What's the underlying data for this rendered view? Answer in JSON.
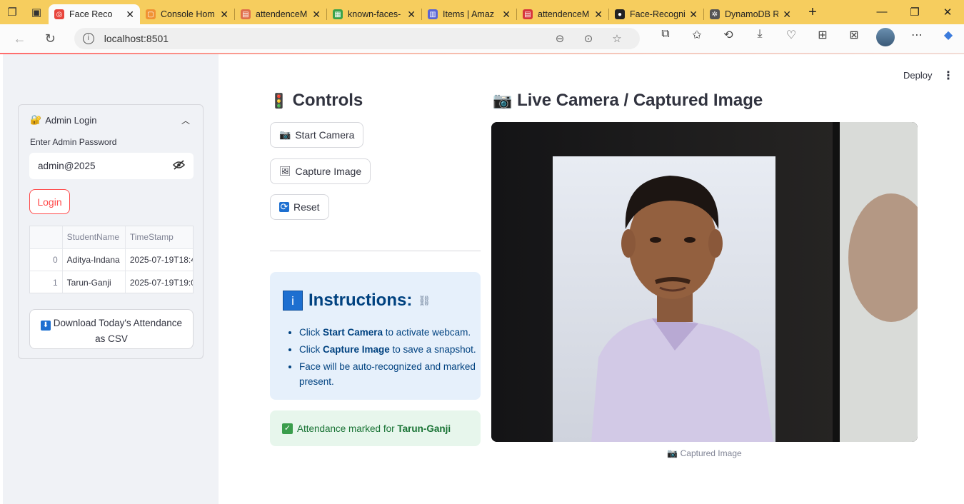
{
  "browser": {
    "tabs": [
      {
        "title": "Face Reco",
        "active": true,
        "fav_color": "#e8453c"
      },
      {
        "title": "Console Hom",
        "active": false,
        "fav_color": "#f09233"
      },
      {
        "title": "attendenceM",
        "active": false,
        "fav_color": "#e06e4a"
      },
      {
        "title": "known-faces-",
        "active": false,
        "fav_color": "#3aa24a"
      },
      {
        "title": "Items | Amaz",
        "active": false,
        "fav_color": "#5964d6"
      },
      {
        "title": "attendenceM",
        "active": false,
        "fav_color": "#d7353c"
      },
      {
        "title": "Face-Recogni",
        "active": false,
        "fav_color": "#222222"
      },
      {
        "title": "DynamoDB R",
        "active": false,
        "fav_color": "#555555"
      }
    ],
    "url": "localhost:8501"
  },
  "sidebar": {
    "section_title": "Admin Login",
    "password_label": "Enter Admin Password",
    "password_value": "admin@2025",
    "login_label": "Login",
    "table": {
      "columns": [
        "",
        "StudentName",
        "TimeStamp"
      ],
      "rows": [
        [
          "0",
          "Aditya-Indana",
          "2025-07-19T18:4"
        ],
        [
          "1",
          "Tarun-Ganji",
          "2025-07-19T19:0"
        ]
      ]
    },
    "download_label_line1": "Download Today's Attendance",
    "download_label_line2": "as CSV"
  },
  "header": {
    "deploy_label": "Deploy"
  },
  "controls": {
    "title": "Controls",
    "start_camera": "Start Camera",
    "capture_image": "Capture Image",
    "reset": "Reset"
  },
  "instructions": {
    "title": "Instructions:",
    "items": [
      {
        "pre": "Click ",
        "bold": "Start Camera",
        "post": " to activate webcam."
      },
      {
        "pre": "Click ",
        "bold": "Capture Image",
        "post": " to save a snapshot."
      },
      {
        "pre": "Face will be auto-recognized and marked present.",
        "bold": "",
        "post": ""
      }
    ]
  },
  "status": {
    "prefix": "Attendance marked for ",
    "name": "Tarun-Ganji"
  },
  "camera": {
    "title": "Live Camera / Captured Image",
    "caption": "Captured Image"
  },
  "colors": {
    "accent": "#ff4b4b",
    "info_bg": "#e6f0fb",
    "success_bg": "#e7f6ec",
    "tabbar": "#f6cd5e"
  }
}
